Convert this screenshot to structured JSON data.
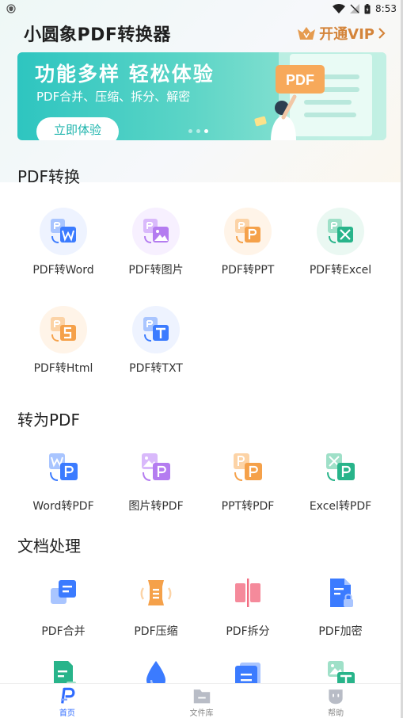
{
  "status_bar": {
    "time": "8:53"
  },
  "header": {
    "title": "小圆象PDF转换器",
    "vip_label": "开通VIP"
  },
  "banner": {
    "title": "功能多样  轻松体验",
    "subtitle": "PDF合并、压缩、拆分、解密",
    "button_label": "立即体验",
    "art_label": "PDF"
  },
  "sections": {
    "pdf_convert": {
      "title": "PDF转换",
      "items": [
        {
          "label": "PDF转Word"
        },
        {
          "label": "PDF转图片"
        },
        {
          "label": "PDF转PPT"
        },
        {
          "label": "PDF转Excel"
        },
        {
          "label": "PDF转Html"
        },
        {
          "label": "PDF转TXT"
        }
      ]
    },
    "to_pdf": {
      "title": "转为PDF",
      "items": [
        {
          "label": "Word转PDF"
        },
        {
          "label": "图片转PDF"
        },
        {
          "label": "PPT转PDF"
        },
        {
          "label": "Excel转PDF"
        }
      ]
    },
    "doc_process": {
      "title": "文档处理",
      "items": [
        {
          "label": "PDF合并"
        },
        {
          "label": "PDF压缩"
        },
        {
          "label": "PDF拆分"
        },
        {
          "label": "PDF加密"
        }
      ]
    }
  },
  "bottom_nav": {
    "items": [
      {
        "label": "首页",
        "icon": "home-p-icon"
      },
      {
        "label": "文件库",
        "icon": "folder-icon"
      },
      {
        "label": "帮助",
        "icon": "help-face-icon"
      }
    ]
  },
  "colors": {
    "accent": "#2f6bff",
    "vip": "#d4843a",
    "banner_start": "#2ec5c0",
    "word": "#3b7bff",
    "image": "#b47cf0",
    "ppt": "#f5a14a",
    "excel": "#28b48a"
  }
}
